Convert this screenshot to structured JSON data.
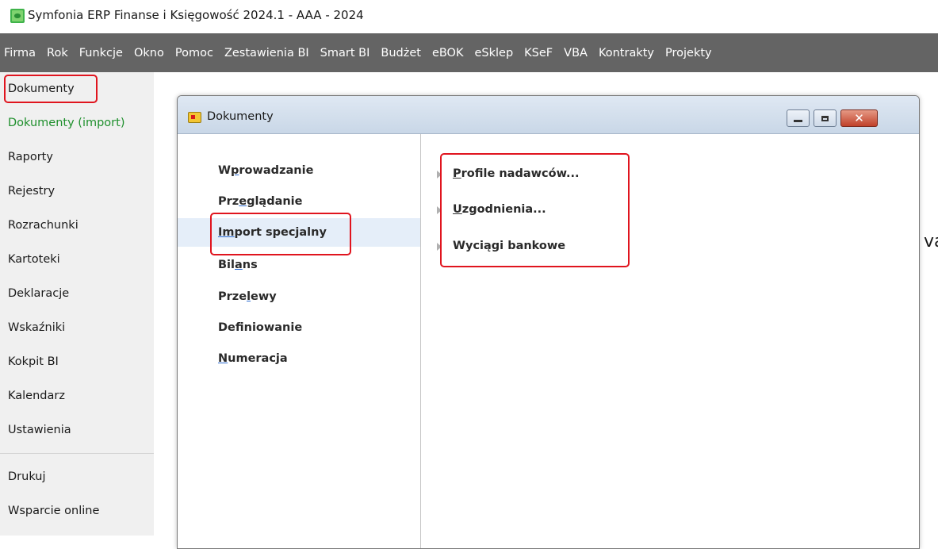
{
  "window": {
    "title": "Symfonia ERP Finanse i Księgowość 2024.1 - AAA - 2024",
    "icon": "symfonia-app-icon"
  },
  "menubar": {
    "items": [
      "Firma",
      "Rok",
      "Funkcje",
      "Okno",
      "Pomoc",
      "Zestawienia BI",
      "Smart BI",
      "Budżet",
      "eBOK",
      "eSklep",
      "KSeF",
      "VBA",
      "Kontrakty",
      "Projekty"
    ]
  },
  "sidebar": {
    "items": [
      {
        "label": "Dokumenty"
      },
      {
        "label": "Dokumenty (import)"
      },
      {
        "label": "Raporty"
      },
      {
        "label": "Rejestry"
      },
      {
        "label": "Rozrachunki"
      },
      {
        "label": "Kartoteki"
      },
      {
        "label": "Deklaracje"
      },
      {
        "label": "Wskaźniki"
      },
      {
        "label": "Kokpit BI"
      },
      {
        "label": "Kalendarz"
      },
      {
        "label": "Ustawienia"
      }
    ],
    "bottom_items": [
      {
        "label": "Drukuj"
      },
      {
        "label": "Wsparcie online"
      }
    ]
  },
  "dialog": {
    "title": "Dokumenty",
    "close_glyph": "✕",
    "left_menu": [
      {
        "before": "W",
        "key": "p",
        "after": "rowadzanie"
      },
      {
        "before": "Prz",
        "key": "e",
        "after": "glądanie"
      },
      {
        "before": "",
        "key": "Im",
        "after": "port specjalny"
      },
      {
        "before": "Bil",
        "key": "a",
        "after": "ns"
      },
      {
        "before": "Prze",
        "key": "l",
        "after": "ewy"
      },
      {
        "before": "Def",
        "key": "i",
        "after": "niowanie"
      },
      {
        "before": "",
        "key": "N",
        "after": "umeracja"
      }
    ],
    "right_menu": [
      {
        "key": "P",
        "after": "rofile nadawców..."
      },
      {
        "key": "U",
        "after": "zgodnienia..."
      },
      {
        "key": "",
        "after": "Wyciągi bankowe"
      }
    ]
  },
  "background": {
    "edge_text": "va"
  },
  "colors": {
    "menubar_bg": "#646464",
    "sidebar_bg": "#f0f0f0",
    "highlight": "#e0141e",
    "green_text": "#1e8f2c",
    "selection_bg": "#e5eef9"
  }
}
